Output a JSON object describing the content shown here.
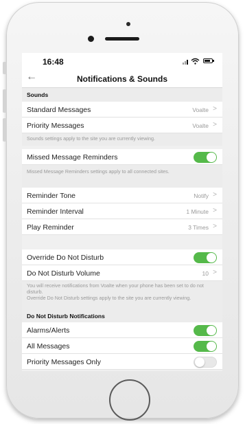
{
  "status_bar": {
    "time": "16:48"
  },
  "nav": {
    "back_icon": "arrow-left-icon",
    "title": "Notifications & Sounds"
  },
  "sounds": {
    "header": "Sounds",
    "standard": {
      "label": "Standard Messages",
      "value": "Voalte"
    },
    "priority": {
      "label": "Priority Messages",
      "value": "Voalte"
    },
    "note": "Sounds settings apply to the site you are currently viewing."
  },
  "missed": {
    "label": "Missed Message Reminders",
    "enabled": true,
    "note": "Missed Message Reminders settings apply to all connected sites."
  },
  "reminder": {
    "tone": {
      "label": "Reminder Tone",
      "value": "Notify"
    },
    "interval": {
      "label": "Reminder Interval",
      "value": "1 Minute"
    },
    "play": {
      "label": "Play Reminder",
      "value": "3 Times"
    }
  },
  "dnd": {
    "override": {
      "label": "Override Do Not Disturb",
      "enabled": true
    },
    "volume": {
      "label": "Do Not Disturb Volume",
      "value": "10"
    },
    "note_line1": "You will receive notifications from Voalte when your phone has been set to do not disturb.",
    "note_line2": "Override Do Not Disturb settings apply to the site you are currently viewing."
  },
  "dnd_notifications": {
    "header": "Do Not Disturb Notifications",
    "alarms": {
      "label": "Alarms/Alerts",
      "enabled": true
    },
    "all": {
      "label": "All Messages",
      "enabled": true
    },
    "priority_only": {
      "label": "Priority Messages Only",
      "enabled": false
    }
  },
  "colors": {
    "toggle_on": "#55b94a",
    "toggle_off": "#e8e8e8",
    "section_bg": "#ececec"
  }
}
